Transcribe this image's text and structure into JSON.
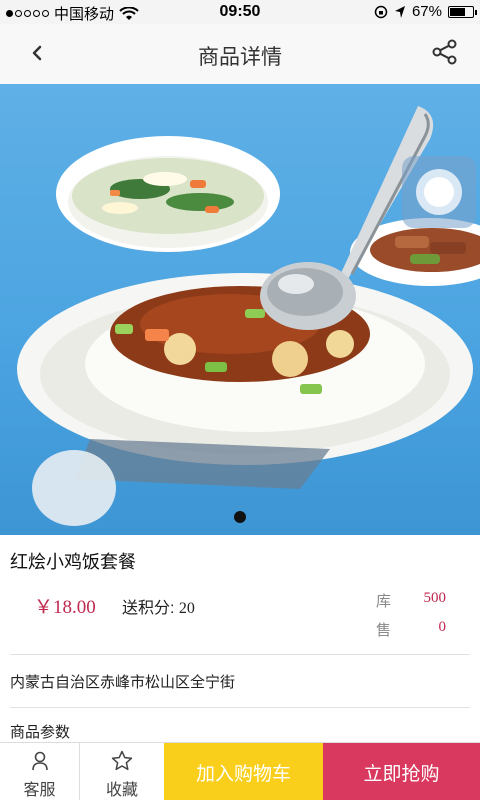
{
  "status_bar": {
    "carrier": "中国移动",
    "time": "09:50",
    "battery": "67%",
    "battery_level": 0.67,
    "signal_dots_filled": 1,
    "signal_dots_total": 5
  },
  "header": {
    "title": "商品详情",
    "back_icon": "chevron-left-icon",
    "share_icon": "share-icon"
  },
  "banner": {
    "current_page": 1,
    "total_pages": 1
  },
  "product": {
    "name": "红烩小鸡饭套餐",
    "price": "￥18.00",
    "points_label": "送积分:",
    "points_value": "20",
    "stock_label": "库",
    "stock_value": "500",
    "sold_label": "售",
    "sold_value": "0",
    "address": "内蒙古自治区赤峰市松山区全宁街",
    "params_label": "商品参数"
  },
  "bottom_bar": {
    "service_label": "客服",
    "favorite_label": "收藏",
    "add_cart_label": "加入购物车",
    "buy_now_label": "立即抢购"
  },
  "colors": {
    "price": "#c0284e",
    "cart": "#f9cf1c",
    "buy": "#d9395e",
    "banner_bg": "#4aa3e0"
  }
}
